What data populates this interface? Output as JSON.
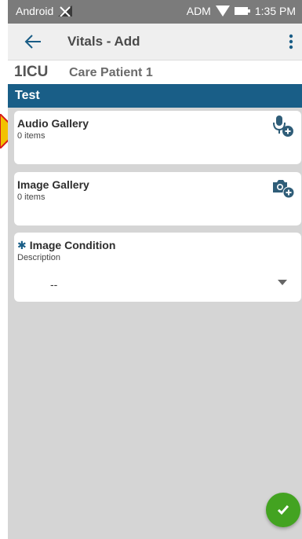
{
  "status_bar": {
    "carrier": "Android",
    "network": "ADM",
    "time": "1:35 PM"
  },
  "app_bar": {
    "title": "Vitals - Add",
    "back_icon": "arrow-left-icon",
    "menu_icon": "more-vert-icon"
  },
  "patient": {
    "unit": "1ICU",
    "name": "Care Patient 1"
  },
  "section": {
    "title": "Test"
  },
  "audio_gallery": {
    "title": "Audio Gallery",
    "count": "0 items",
    "icon": "add-microphone-icon"
  },
  "image_gallery": {
    "title": "Image Gallery",
    "count": "0 items",
    "icon": "add-camera-icon"
  },
  "image_condition": {
    "required_mark": "✱",
    "title": "Image Condition",
    "subtitle": "Description",
    "value": "--"
  },
  "fab": {
    "icon": "check-icon"
  },
  "colors": {
    "header_blue": "#195e87",
    "fab_green": "#43a321",
    "background": "#d5d5d5",
    "pointer": "#f2c200"
  }
}
